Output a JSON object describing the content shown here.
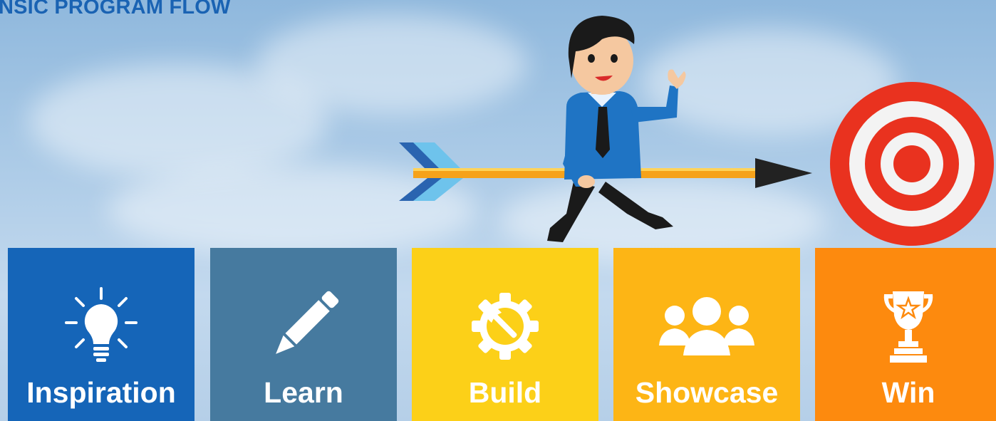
{
  "header": {
    "title": "NSIC PROGRAM FLOW"
  },
  "illustration": {
    "character": "businessman-riding-arrow",
    "goal": "target-icon"
  },
  "steps": [
    {
      "label": "Inspiration",
      "icon": "lightbulb-icon",
      "color": "#1565b8"
    },
    {
      "label": "Learn",
      "icon": "pencil-icon",
      "color": "#467a9f"
    },
    {
      "label": "Build",
      "icon": "gear-wrench-icon",
      "color": "#fcd018"
    },
    {
      "label": "Showcase",
      "icon": "people-group-icon",
      "color": "#fdb515"
    },
    {
      "label": "Win",
      "icon": "trophy-icon",
      "color": "#fd8a0e"
    }
  ]
}
